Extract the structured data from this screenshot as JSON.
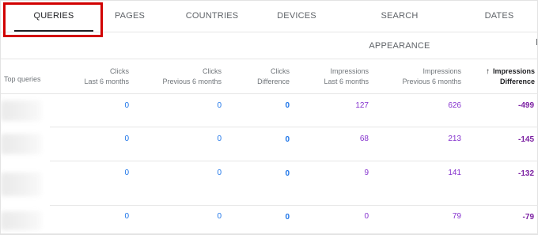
{
  "tabs": [
    {
      "label": "QUERIES",
      "active": true
    },
    {
      "label": "PAGES",
      "active": false
    },
    {
      "label": "COUNTRIES",
      "active": false
    },
    {
      "label": "DEVICES",
      "active": false
    },
    {
      "label": "SEARCH APPEARANCE",
      "active": false
    },
    {
      "label": "DATES",
      "active": false
    }
  ],
  "table": {
    "columns": [
      {
        "line1": "Top queries",
        "line2": ""
      },
      {
        "line1": "Clicks",
        "line2": "Last 6 months"
      },
      {
        "line1": "Clicks",
        "line2": "Previous 6 months"
      },
      {
        "line1": "Clicks",
        "line2": "Difference"
      },
      {
        "line1": "Impressions",
        "line2": "Last 6 months"
      },
      {
        "line1": "Impressions",
        "line2": "Previous 6 months"
      },
      {
        "line1": "Impressions",
        "line2": "Difference",
        "sorted": "descending"
      }
    ],
    "rows": [
      {
        "query": "",
        "clicks_last": "0",
        "clicks_prev": "0",
        "clicks_diff": "0",
        "impr_last": "127",
        "impr_prev": "626",
        "impr_diff": "-499"
      },
      {
        "query": "",
        "clicks_last": "0",
        "clicks_prev": "0",
        "clicks_diff": "0",
        "impr_last": "68",
        "impr_prev": "213",
        "impr_diff": "-145"
      },
      {
        "query": "",
        "clicks_last": "0",
        "clicks_prev": "0",
        "clicks_diff": "0",
        "impr_last": "9",
        "impr_prev": "141",
        "impr_diff": "-132"
      },
      {
        "query": "",
        "clicks_last": "0",
        "clicks_prev": "0",
        "clicks_diff": "0",
        "impr_last": "0",
        "impr_prev": "79",
        "impr_diff": "-79"
      }
    ]
  },
  "colors": {
    "clicks": "#1a73e8",
    "impressions": "#8430ce",
    "highlight": "#d10000"
  },
  "icons": {
    "sort": "arrow-up-icon"
  }
}
